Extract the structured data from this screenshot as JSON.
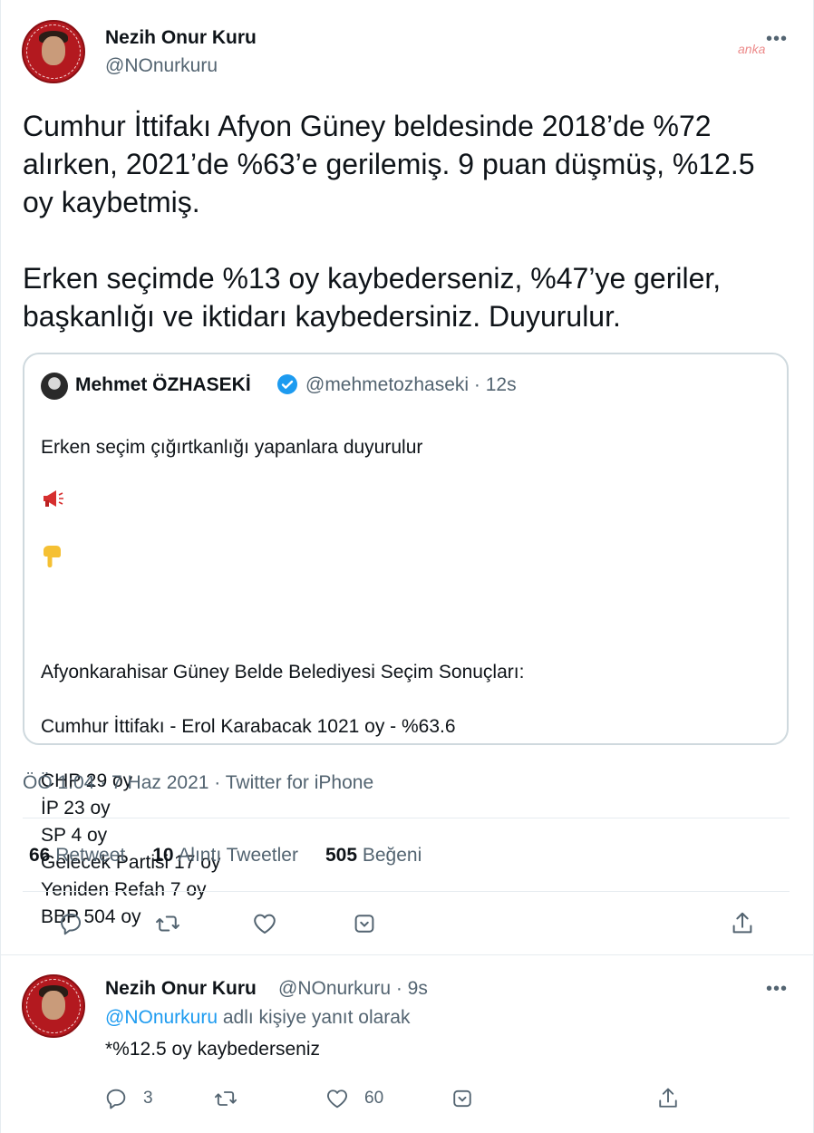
{
  "tweet": {
    "author_name": "Nezih Onur Kuru",
    "author_handle": "@NOnurkuru",
    "more": "•••",
    "text": "Cumhur İttifakı Afyon Güney beldesinde 2018’de %72 alırken, 2021’de %63’e gerilemiş. 9 puan düşmüş, %12.5 oy kaybetmiş.\n\nErken seçimde %13 oy kaybederseniz, %47’ye geriler, başkanlığı ve iktidarı kaybedersiniz. Duyurulur.",
    "timestamp": "ÖÖ 1:04 · 7 Haz 2021 · Twitter for iPhone",
    "stats": {
      "retweets_count": "66",
      "retweets_label": "Retweet",
      "quotes_count": "10",
      "quotes_label": "Alıntı Tweetler",
      "likes_count": "505",
      "likes_label": "Beğeni"
    }
  },
  "quoted": {
    "author_name": "Mehmet ÖZHASEKİ",
    "meta": "@mehmetozhaseki · 12s",
    "line1": "Erken seçim çığırtkanlığı yapanlara duyurulur",
    "text": "Afyonkarahisar Güney Belde Belediyesi Seçim Sonuçları:\n\nCumhur İttifakı - Erol Karabacak 1021 oy - %63.6\n\nCHP 29 oy\nİP 23 oy\nSP 4 oy\nGelecek Partisi 17 oy\nYeniden Refah 7 oy\nBBP 504 oy"
  },
  "reply": {
    "author_name": "Nezih Onur Kuru",
    "meta": "@NOnurkuru · 9s",
    "more": "•••",
    "reply_prefix": "@NOnurkuru",
    "reply_suffix": " adlı kişiye yanıt olarak",
    "text": "*%12.5 oy kaybederseniz",
    "reply_count": "3",
    "like_count": "60"
  },
  "watermark": "anka",
  "colors": {
    "accent": "#1d9bf0",
    "muted": "#536471",
    "border": "#cfd9de"
  }
}
